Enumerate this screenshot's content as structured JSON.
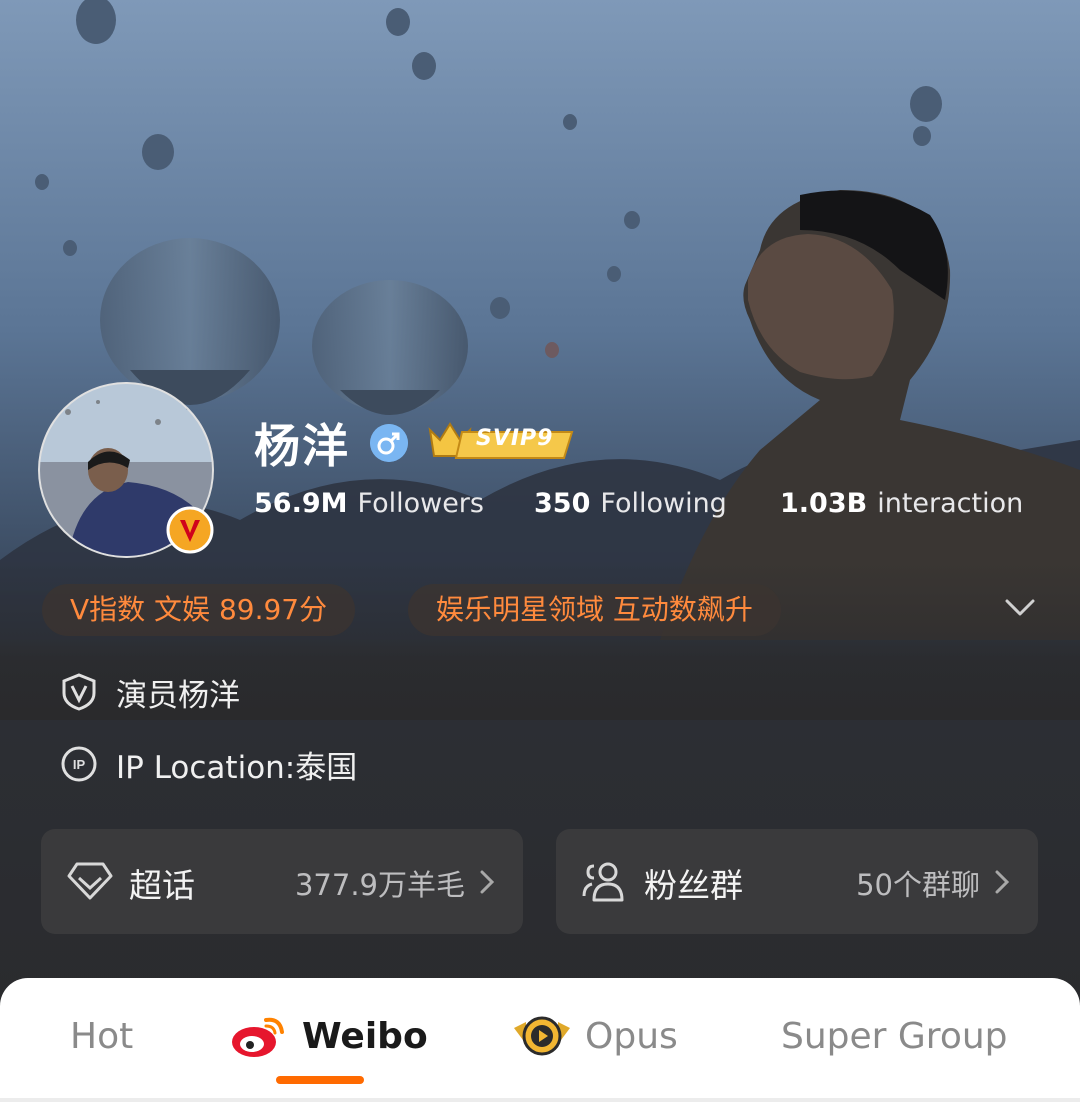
{
  "profile": {
    "name": "杨洋",
    "badge": "SVIP9",
    "stats": [
      {
        "value": "56.9M",
        "label": "Followers"
      },
      {
        "value": "350",
        "label": "Following"
      },
      {
        "value": "1.03B",
        "label": "interaction"
      }
    ],
    "chips": [
      "V指数 文娱 89.97分",
      "娱乐明星领域 互动数飙升"
    ],
    "verified_title": "演员杨洋",
    "ip_location": "IP Location:泰国"
  },
  "cards": {
    "super_topic": {
      "label": "超话",
      "value": "377.9万羊毛"
    },
    "fan_group": {
      "label": "粉丝群",
      "value": "50个群聊"
    }
  },
  "tabs": [
    "Hot",
    "Weibo",
    "Opus",
    "Super Group"
  ],
  "colors": {
    "accent": "#ff6a00",
    "chip_text": "#ff8a3d",
    "background": "#2a2a2c"
  },
  "icons": [
    "verified-shield-icon",
    "ip-icon",
    "diamond-icon",
    "users-icon",
    "chevron-down-icon",
    "chevron-right-icon",
    "weibo-logo-icon",
    "opus-icon",
    "gender-male-icon",
    "vip-v-badge-icon"
  ]
}
